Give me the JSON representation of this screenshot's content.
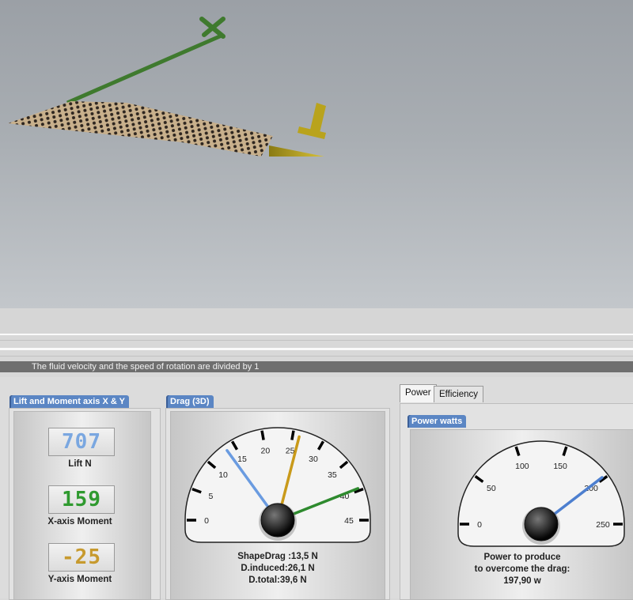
{
  "status": {
    "message": "The fluid velocity and the speed of rotation are divided by 1"
  },
  "lift_panel": {
    "title": "Lift and Moment axis X & Y",
    "lift": {
      "value": "707",
      "label": "Lift N",
      "color": "#7aa7e0"
    },
    "x_moment": {
      "value": "159",
      "label": "X-axis Moment",
      "color": "#2f9a2f"
    },
    "y_moment": {
      "value": "-25",
      "label": "Y-axis Moment",
      "color": "#c79a2e"
    }
  },
  "drag_panel": {
    "title": "Drag (3D)",
    "gauge": {
      "min": 0,
      "max": 45,
      "ticks": [
        "0",
        "5",
        "10",
        "15",
        "20",
        "25",
        "30",
        "35",
        "40",
        "45"
      ],
      "needles": [
        {
          "name": "shape-drag",
          "value": 13.5,
          "color": "#6a9be0"
        },
        {
          "name": "induced-drag",
          "value": 26.1,
          "color": "#c99a1a"
        },
        {
          "name": "total-drag",
          "value": 39.6,
          "color": "#2e8a2e"
        }
      ]
    },
    "lines": [
      "ShapeDrag :13,5 N",
      "D.induced:26,1 N",
      "D.total:39,6 N"
    ]
  },
  "power_panel": {
    "tabs": [
      "Power",
      "Efficiency"
    ],
    "active_tab": "Power",
    "title": "Power watts",
    "gauge": {
      "min": 0,
      "max": 250,
      "ticks": [
        "0",
        "50",
        "100",
        "150",
        "200",
        "250"
      ],
      "needles": [
        {
          "name": "power",
          "value": 197.9,
          "color": "#4d7fcf"
        }
      ]
    },
    "lines": [
      "Power to produce",
      "to overcome the drag:",
      "197,90 w"
    ]
  }
}
